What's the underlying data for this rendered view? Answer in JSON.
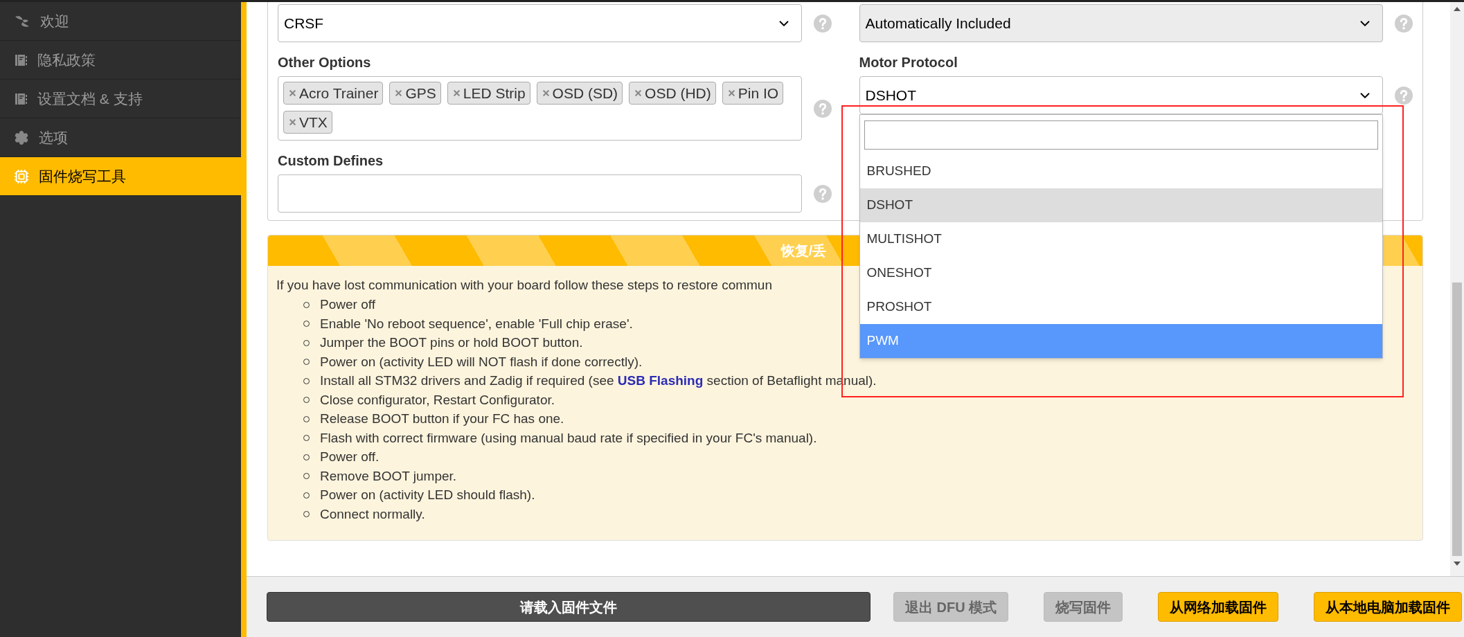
{
  "sidebar": {
    "items": [
      {
        "label": "欢迎",
        "kind": "welcome",
        "selected": false
      },
      {
        "label": "隐私政策",
        "kind": "document",
        "selected": false
      },
      {
        "label": "设置文档 & 支持",
        "kind": "document",
        "selected": false
      },
      {
        "label": "选项",
        "kind": "settings",
        "selected": false
      },
      {
        "label": "固件烧写工具",
        "kind": "firmware",
        "selected": true
      }
    ]
  },
  "form": {
    "left": {
      "select": {
        "value": "CRSF",
        "disabled": false
      },
      "other_options": {
        "label": "Other Options",
        "tags": [
          "Acro Trainer",
          "GPS",
          "LED Strip",
          "OSD (SD)",
          "OSD (HD)",
          "Pin IO",
          "VTX"
        ]
      },
      "custom_defines": {
        "label": "Custom Defines"
      }
    },
    "right": {
      "select": {
        "value": "Automatically Included",
        "disabled": true
      },
      "motor_protocol": {
        "label": "Motor Protocol",
        "value": "DSHOT",
        "expanded": true,
        "options": [
          {
            "label": "BRUSHED",
            "selected": false,
            "highlighted": false
          },
          {
            "label": "DSHOT",
            "selected": true,
            "highlighted": false
          },
          {
            "label": "MULTISHOT",
            "selected": false,
            "highlighted": false
          },
          {
            "label": "ONESHOT",
            "selected": false,
            "highlighted": false
          },
          {
            "label": "PROSHOT",
            "selected": false,
            "highlighted": false
          },
          {
            "label": "PWM",
            "selected": false,
            "highlighted": true
          }
        ]
      }
    }
  },
  "recovery": {
    "title": "恢复/丢",
    "intro": "If you have lost communication with your board follow these steps to restore commun",
    "steps": [
      {
        "text": "Power off"
      },
      {
        "text": "Enable 'No reboot sequence', enable 'Full chip erase'."
      },
      {
        "text": "Jumper the BOOT pins or hold BOOT button."
      },
      {
        "text": "Power on (activity LED will NOT flash if done correctly)."
      },
      {
        "text": "Install all STM32 drivers and Zadig if required (see ",
        "link": "USB Flashing",
        "after": " section of Betaflight manual)."
      },
      {
        "text": "Close configurator, Restart Configurator."
      },
      {
        "text": "Release BOOT button if your FC has one."
      },
      {
        "text": "Flash with correct firmware (using manual baud rate if specified in your FC's manual)."
      },
      {
        "text": "Power off."
      },
      {
        "text": "Remove BOOT jumper."
      },
      {
        "text": "Power on (activity LED should flash)."
      },
      {
        "text": "Connect normally."
      }
    ]
  },
  "buttons": [
    {
      "label": "请载入固件文件",
      "kind": "dark",
      "disabled": false
    },
    {
      "label": "退出 DFU 模式",
      "kind": "plain",
      "disabled": true
    },
    {
      "label": "烧写固件",
      "kind": "plain",
      "disabled": true
    },
    {
      "label": "从网络加载固件",
      "kind": "yellow",
      "disabled": false
    },
    {
      "label": "从本地电脑加载固件",
      "kind": "yellow",
      "disabled": false
    }
  ]
}
